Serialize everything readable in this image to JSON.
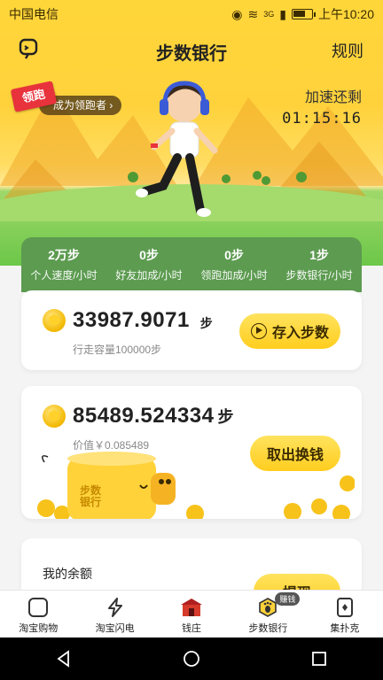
{
  "status_bar": {
    "carrier": "中国电信",
    "time": "上午10:20",
    "network": "3G"
  },
  "nav": {
    "title": "步数银行",
    "rules": "规则"
  },
  "leader": {
    "flag": "领跑",
    "cta": "成为领跑者"
  },
  "speedup": {
    "label": "加速还剩",
    "countdown": "01:15:16"
  },
  "stats": [
    {
      "value": "2万步",
      "label": "个人速度/小时"
    },
    {
      "value": "0步",
      "label": "好友加成/小时"
    },
    {
      "value": "0步",
      "label": "领跑加成/小时"
    },
    {
      "value": "1步",
      "label": "步数银行/小时"
    }
  ],
  "deposit": {
    "steps": "33987.9071",
    "unit": "步",
    "capacity": "行走容量100000步",
    "button": "存入步数"
  },
  "withdraw": {
    "steps": "85489.524334",
    "unit": "步",
    "value": "价值￥0.085489",
    "button": "取出换钱",
    "piggy_text": "步数\n银行"
  },
  "balance": {
    "label": "我的余额",
    "button": "提现"
  },
  "tabs": [
    {
      "label": "淘宝购物",
      "icon": "taobao-bag-icon"
    },
    {
      "label": "淘宝闪电",
      "icon": "lightning-icon"
    },
    {
      "label": "钱庄",
      "icon": "bank-house-icon"
    },
    {
      "label": "步数银行",
      "icon": "footprint-icon",
      "badge": "赚钱"
    },
    {
      "label": "集扑克",
      "icon": "poker-card-icon"
    }
  ],
  "colors": {
    "accent_yellow": "#ffcd1e",
    "stats_green": "#5c9b50",
    "leader_red": "#e8323c"
  }
}
